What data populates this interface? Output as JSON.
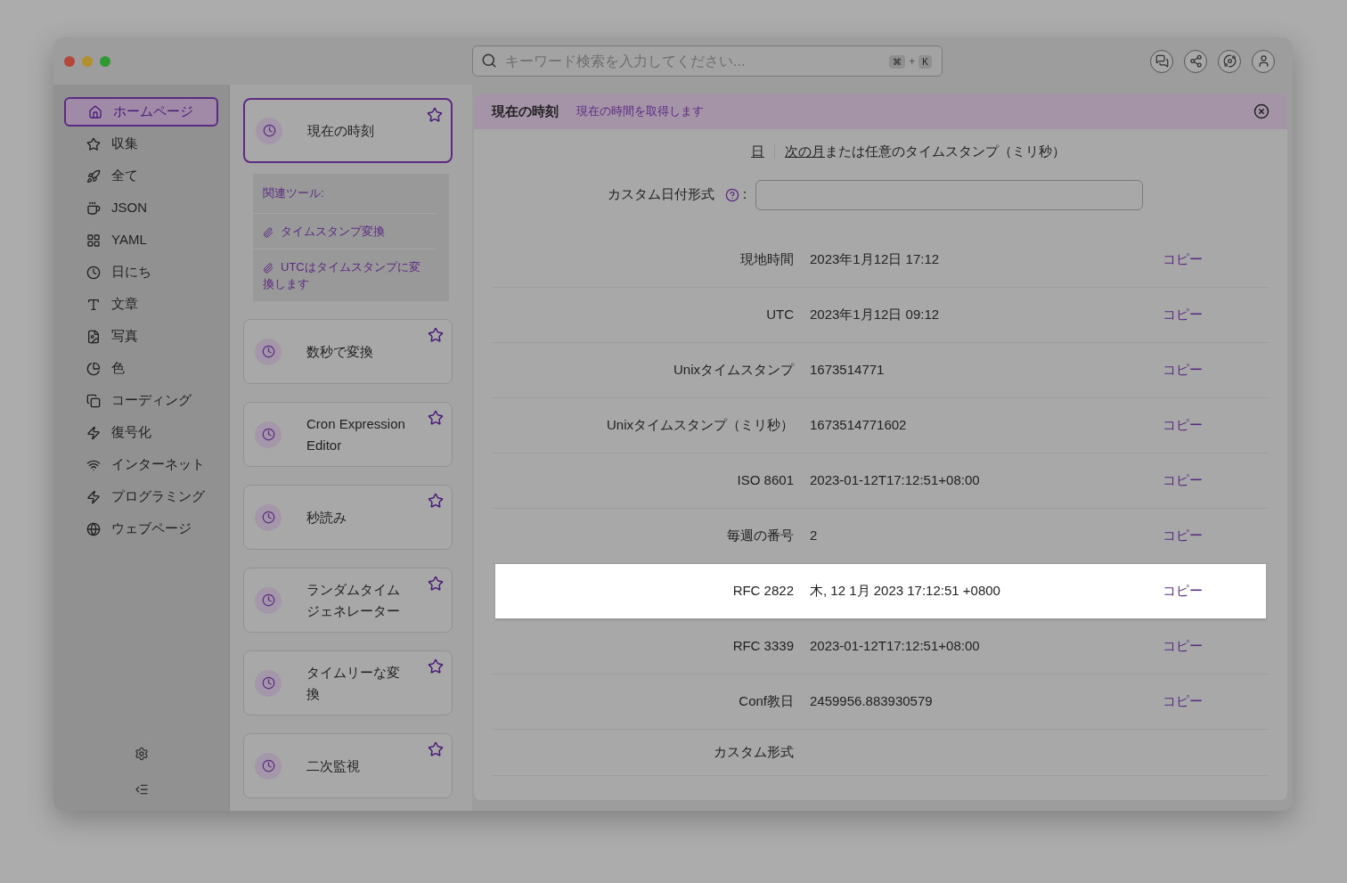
{
  "search": {
    "placeholder": "キーワード検索を入力してください...",
    "keys": [
      "⌘",
      "+",
      "K"
    ]
  },
  "sidebar": {
    "items": [
      {
        "label": "ホームページ",
        "selected": true
      },
      {
        "label": "収集",
        "selected": false
      },
      {
        "label": "全て",
        "selected": false
      },
      {
        "label": "JSON",
        "selected": false
      },
      {
        "label": "YAML",
        "selected": false
      },
      {
        "label": "日にち",
        "selected": false
      },
      {
        "label": "文章",
        "selected": false
      },
      {
        "label": "写真",
        "selected": false
      },
      {
        "label": "色",
        "selected": false
      },
      {
        "label": "コーディング",
        "selected": false
      },
      {
        "label": "復号化",
        "selected": false
      },
      {
        "label": "インターネット",
        "selected": false
      },
      {
        "label": "プログラミング",
        "selected": false
      },
      {
        "label": "ウェブページ",
        "selected": false
      }
    ]
  },
  "tools": [
    {
      "title": "現在の時刻",
      "selected": true,
      "related": {
        "heading": "関連ツール:",
        "links": [
          "タイムスタンプ変換",
          "UTCはタイムスタンプに変換します"
        ]
      }
    },
    {
      "title": "数秒で変換",
      "selected": false
    },
    {
      "title": "Cron Expression Editor",
      "selected": false
    },
    {
      "title": "秒読み",
      "selected": false
    },
    {
      "title": "ランダムタイムジェネレーター",
      "selected": false
    },
    {
      "title": "タイムリーな変換",
      "selected": false
    },
    {
      "title": "二次監視",
      "selected": false
    }
  ],
  "panel": {
    "title": "現在の時刻",
    "subtitle": "現在の時間を取得します",
    "hint": [
      {
        "kind": "link",
        "text": "日"
      },
      {
        "kind": "separator"
      },
      {
        "kind": "link",
        "text": "次の月"
      },
      {
        "kind": "plain",
        "text": "または任意のタイムスタンプ（ミリ秒）"
      }
    ],
    "custom_format": {
      "label": "カスタム日付形式",
      "suffix": ":"
    },
    "rows": [
      {
        "label": "現地時間",
        "value": "2023年1月12日 17:12",
        "action": "コピー",
        "selected": false
      },
      {
        "label": "UTC",
        "value": "2023年1月12日 09:12",
        "action": "コピー",
        "selected": false
      },
      {
        "label": "Unixタイムスタンプ",
        "value": "1673514771",
        "action": "コピー",
        "selected": false
      },
      {
        "label": "Unixタイムスタンプ（ミリ秒）",
        "value": "1673514771602",
        "action": "コピー",
        "selected": false
      },
      {
        "label": "ISO 8601",
        "value": "2023-01-12T17:12:51+08:00",
        "action": "コピー",
        "selected": false
      },
      {
        "label": "毎週の番号",
        "value": "2",
        "action": "コピー",
        "selected": false
      },
      {
        "label": "RFC 2822",
        "value": "木, 12 1月 2023 17:12:51 +0800",
        "action": "コピー",
        "selected": true
      },
      {
        "label": "RFC 3339",
        "value": "2023-01-12T17:12:51+08:00",
        "action": "コピー",
        "selected": false
      },
      {
        "label": "Conf教日",
        "value": "2459956.883930579",
        "action": "コピー",
        "selected": false
      },
      {
        "label": "カスタム形式",
        "selected": false
      }
    ]
  }
}
